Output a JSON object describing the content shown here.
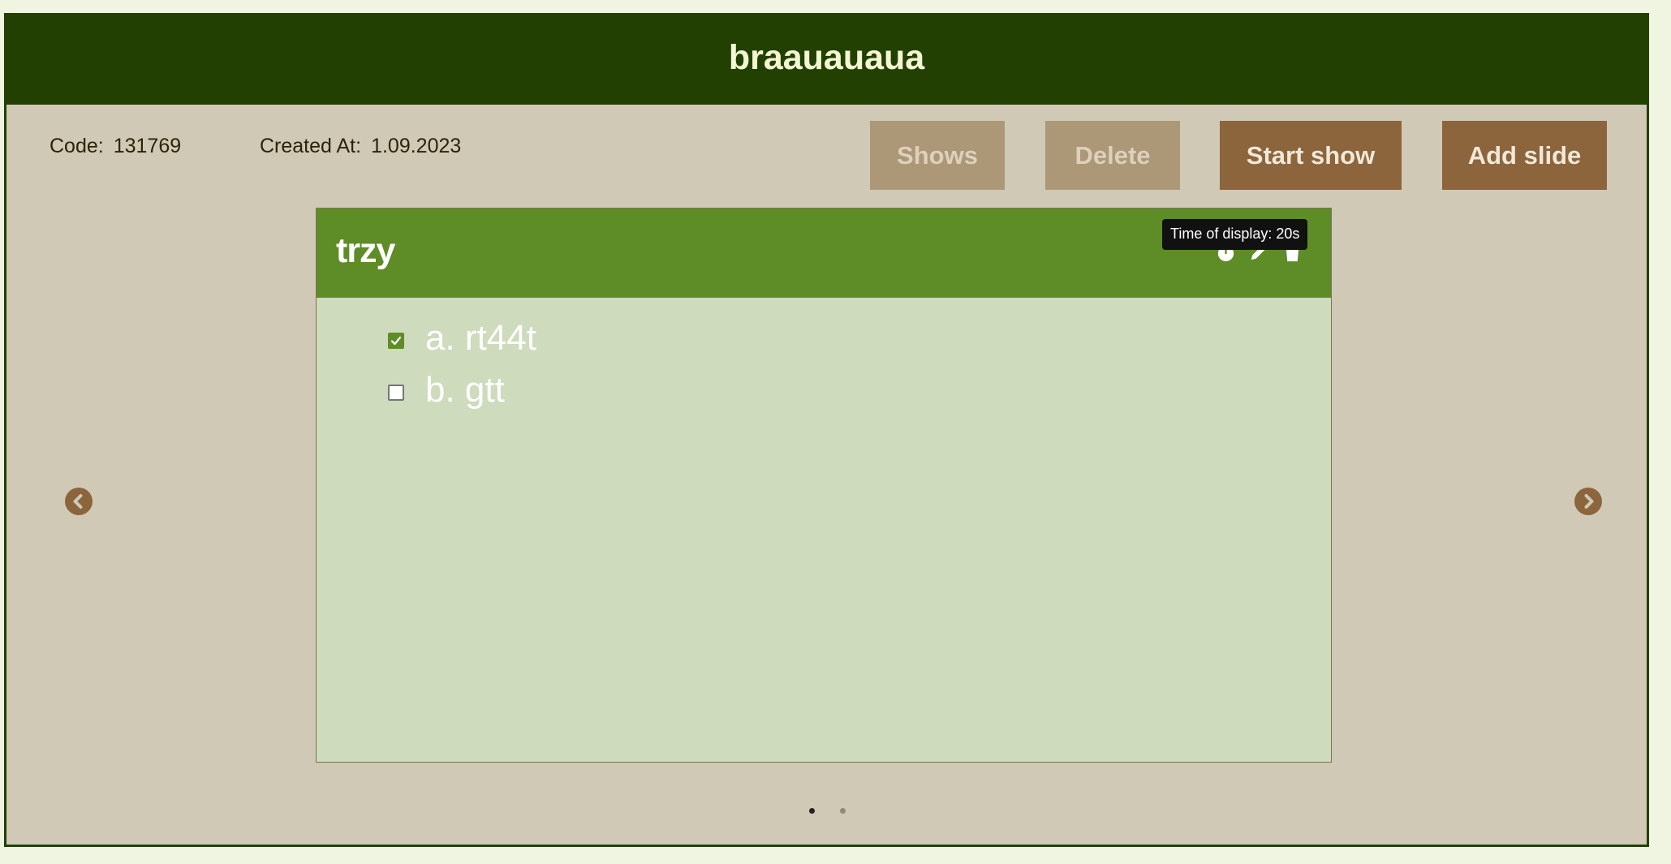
{
  "header": {
    "title": "braauauaua"
  },
  "meta": {
    "code_label": "Code:",
    "code_value": "131769",
    "created_label": "Created At:",
    "created_value": "1.09.2023"
  },
  "toolbar": {
    "shows_label": "Shows",
    "delete_label": "Delete",
    "start_show_label": "Start show",
    "add_slide_label": "Add slide"
  },
  "slide": {
    "title": "trzy",
    "tooltip": "Time of display: 20s",
    "icons": [
      "stopwatch-icon",
      "pencil-icon",
      "trash-icon"
    ],
    "options": [
      {
        "label": "a. rt44t",
        "checked": true
      },
      {
        "label": "b. gtt",
        "checked": false
      }
    ]
  },
  "carousel": {
    "slide_count": 2,
    "active_index": 0
  },
  "colors": {
    "page_background": "#f0f5e2",
    "header_background": "#234003",
    "panel_background": "#d0c9b6",
    "slide_header": "#5e8c27",
    "slide_body": "#cedbbd",
    "button_active": "#8c653d",
    "button_disabled": "#ac9777"
  }
}
